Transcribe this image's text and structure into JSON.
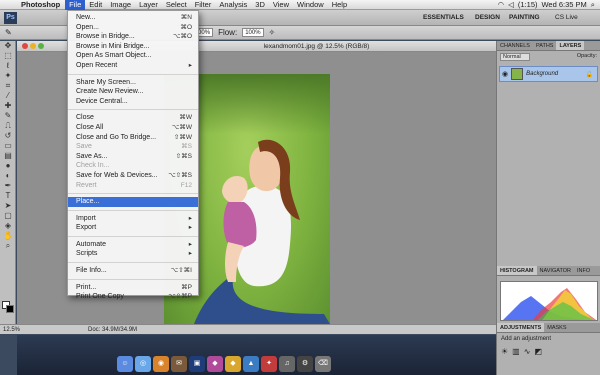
{
  "menubar": {
    "app_name": "Photoshop",
    "items": [
      "File",
      "Edit",
      "Image",
      "Layer",
      "Select",
      "Filter",
      "Analysis",
      "3D",
      "View",
      "Window",
      "Help"
    ],
    "battery": "(1:15)",
    "clock": "Wed 6:35 PM"
  },
  "appbar": {
    "logo": "Ps",
    "workspaces": [
      "ESSENTIALS",
      "DESIGN",
      "PAINTING"
    ],
    "cs_live": "CS Live"
  },
  "options": {
    "flow_label": "Flow:",
    "flow_value": "100%",
    "opacity_value": "100%"
  },
  "document": {
    "tab_title": "lexandmom01.jpg @ 12.5% (RGB/8)",
    "zoom": "12.5%",
    "doc_size": "Doc: 34.9M/34.9M"
  },
  "file_menu": {
    "items": [
      {
        "label": "New...",
        "shortcut": "⌘N"
      },
      {
        "label": "Open...",
        "shortcut": "⌘O"
      },
      {
        "label": "Browse in Bridge...",
        "shortcut": "⌥⌘O"
      },
      {
        "label": "Browse in Mini Bridge...",
        "shortcut": ""
      },
      {
        "label": "Open As Smart Object...",
        "shortcut": ""
      },
      {
        "label": "Open Recent",
        "shortcut": "▸"
      },
      {
        "sep": true
      },
      {
        "label": "Share My Screen...",
        "shortcut": ""
      },
      {
        "label": "Create New Review...",
        "shortcut": ""
      },
      {
        "label": "Device Central...",
        "shortcut": ""
      },
      {
        "sep": true
      },
      {
        "label": "Close",
        "shortcut": "⌘W"
      },
      {
        "label": "Close All",
        "shortcut": "⌥⌘W"
      },
      {
        "label": "Close and Go To Bridge...",
        "shortcut": "⇧⌘W"
      },
      {
        "label": "Save",
        "shortcut": "⌘S",
        "disabled": true
      },
      {
        "label": "Save As...",
        "shortcut": "⇧⌘S"
      },
      {
        "label": "Check In...",
        "shortcut": "",
        "disabled": true
      },
      {
        "label": "Save for Web & Devices...",
        "shortcut": "⌥⇧⌘S"
      },
      {
        "label": "Revert",
        "shortcut": "F12",
        "disabled": true
      },
      {
        "sep": true
      },
      {
        "label": "Place...",
        "shortcut": "",
        "highlight": true
      },
      {
        "sep": true
      },
      {
        "label": "Import",
        "shortcut": "▸"
      },
      {
        "label": "Export",
        "shortcut": "▸"
      },
      {
        "sep": true
      },
      {
        "label": "Automate",
        "shortcut": "▸"
      },
      {
        "label": "Scripts",
        "shortcut": "▸"
      },
      {
        "sep": true
      },
      {
        "label": "File Info...",
        "shortcut": "⌥⇧⌘I"
      },
      {
        "sep": true
      },
      {
        "label": "Print...",
        "shortcut": "⌘P"
      },
      {
        "label": "Print One Copy",
        "shortcut": "⌥⇧⌘P"
      }
    ]
  },
  "layers_panel": {
    "tabs": [
      "CHANNELS",
      "PATHS",
      "LAYERS"
    ],
    "blend_mode": "Normal",
    "opacity_label": "Opacity:",
    "layer_name": "Background"
  },
  "histogram_panel": {
    "tabs": [
      "HISTOGRAM",
      "NAVIGATOR",
      "INFO"
    ]
  },
  "adjustments_panel": {
    "tabs": [
      "ADJUSTMENTS",
      "MASKS"
    ],
    "hint": "Add an adjustment"
  },
  "colors": {
    "menu_highlight": "#3a6fd8",
    "layer_selected": "#a9c5ea"
  }
}
